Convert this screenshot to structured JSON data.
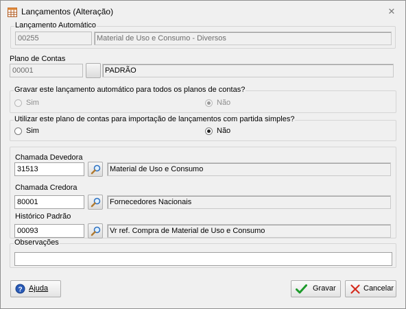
{
  "window": {
    "title": "Lançamentos (Alteração)",
    "close_glyph": "✕",
    "icon": "spreadsheet-icon"
  },
  "lancamento_automatico": {
    "caption": "Lançamento Automático",
    "code": "00255",
    "description": "Material de Uso e Consumo - Diversos"
  },
  "plano_de_contas": {
    "label": "Plano de Contas",
    "code": "00001",
    "description": "PADRÃO"
  },
  "gravar_group": {
    "caption": "Gravar este lançamento automático para todos os planos de contas?",
    "options": [
      "Sim",
      "Não"
    ],
    "selected": "Não",
    "enabled": false
  },
  "utilizar_group": {
    "caption": "Utilizar este plano de contas para importação de lançamentos com partida simples?",
    "options": [
      "Sim",
      "Não"
    ],
    "selected": "Não",
    "enabled": true
  },
  "chamada_devedora": {
    "label": "Chamada Devedora",
    "code": "31513",
    "description": "Material de Uso e Consumo"
  },
  "chamada_credora": {
    "label": "Chamada Credora",
    "code": "80001",
    "description": "Fornecedores Nacionais"
  },
  "historico_padrao": {
    "label": "Histórico Padrão",
    "code": "00093",
    "description": "Vr ref. Compra de Material de Uso e Consumo"
  },
  "observacoes": {
    "caption": "Observações",
    "value": ""
  },
  "buttons": {
    "help": "Ajuda",
    "save": "Gravar",
    "cancel": "Cancelar"
  },
  "colors": {
    "window_bg": "#f0f0f0",
    "save_check": "#1c9a2a",
    "cancel_x": "#d42b1e",
    "help_icon": "#2a5bb8"
  }
}
